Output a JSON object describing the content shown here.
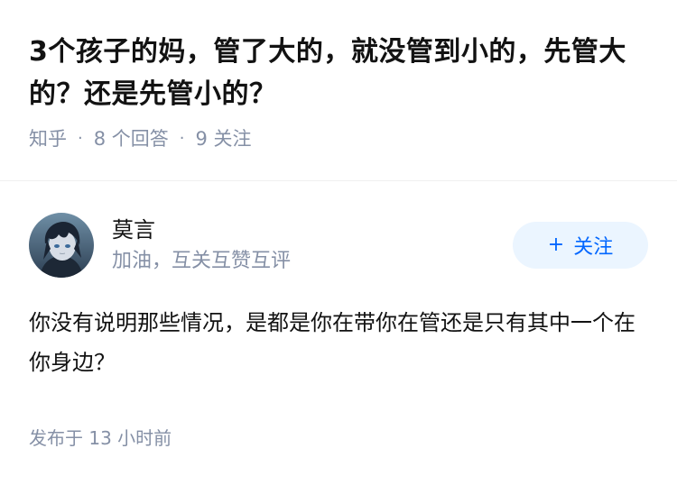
{
  "question": {
    "title": "3个孩子的妈，管了大的，就没管到小的，先管大的？还是先管小的？",
    "source": "知乎",
    "answers_count": "8 个回答",
    "followers_count": "9 关注",
    "separator": "·"
  },
  "answer": {
    "author": {
      "name": "莫言",
      "headline": "加油，互关互赞互评",
      "avatar_icon": "anime-avatar"
    },
    "follow_button": {
      "icon": "plus-icon",
      "icon_glyph": "+",
      "label": "关注"
    },
    "content": "你没有说明那些情况，是都是你在带你在管还是只有其中一个在你身边？",
    "time": "发布于 13 小时前"
  },
  "colors": {
    "text_primary": "#121212",
    "text_secondary": "#8590a6",
    "accent": "#0066ff",
    "accent_bg": "#ebf5ff"
  }
}
